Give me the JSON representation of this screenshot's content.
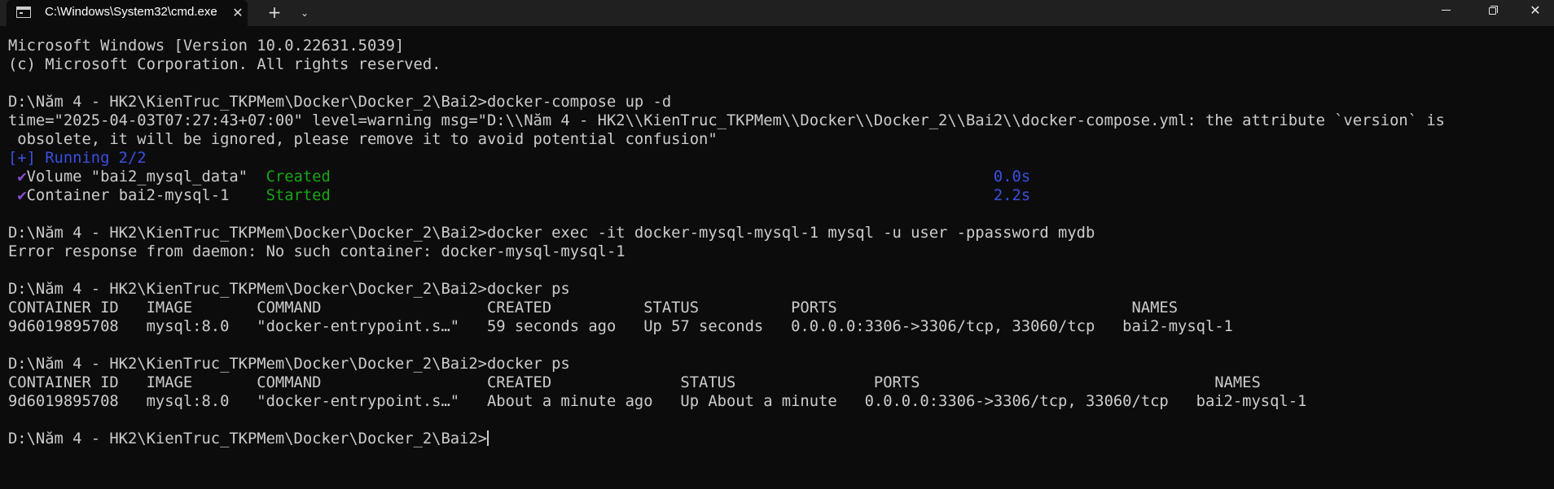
{
  "window": {
    "tab_title": "C:\\Windows\\System32\\cmd.exe",
    "close_tab_glyph": "✕",
    "new_tab_glyph": "+",
    "dropdown_glyph": "⌄",
    "close_window_glyph": "✕"
  },
  "terminal": {
    "banner_line1": "Microsoft Windows [Version 10.0.22631.5039]",
    "banner_line2": "(c) Microsoft Corporation. All rights reserved.",
    "cmd1": "D:\\Năm 4 - HK2\\KienTruc_TKPMem\\Docker\\Docker_2\\Bai2>docker-compose up -d",
    "warn_line1": "time=\"2025-04-03T07:27:43+07:00\" level=warning msg=\"D:\\\\Năm 4 - HK2\\\\KienTruc_TKPMem\\\\Docker\\\\Docker_2\\\\Bai2\\\\docker-compose.yml: the attribute `version` is",
    "warn_line2": " obsolete, it will be ignored, please remove it to avoid potential confusion\"",
    "running": "[+] Running 2/2",
    "check_glyph": "✔",
    "vol_label": "Volume \"bai2_mysql_data\"  ",
    "vol_status": "Created",
    "vol_time": "0.0s",
    "cont_label": "Container bai2-mysql-1    ",
    "cont_status": "Started",
    "cont_time": "2.2s",
    "cmd2": "D:\\Năm 4 - HK2\\KienTruc_TKPMem\\Docker\\Docker_2\\Bai2>docker exec -it docker-mysql-mysql-1 mysql -u user -ppassword mydb",
    "error_line": "Error response from daemon: No such container: docker-mysql-mysql-1",
    "cmd3": "D:\\Năm 4 - HK2\\KienTruc_TKPMem\\Docker\\Docker_2\\Bai2>docker ps",
    "ps1_header": "CONTAINER ID   IMAGE       COMMAND                  CREATED          STATUS          PORTS                                NAMES",
    "ps1_row": "9d6019895708   mysql:8.0   \"docker-entrypoint.s…\"   59 seconds ago   Up 57 seconds   0.0.0.0:3306->3306/tcp, 33060/tcp   bai2-mysql-1",
    "cmd4": "D:\\Năm 4 - HK2\\KienTruc_TKPMem\\Docker\\Docker_2\\Bai2>docker ps",
    "ps2_header": "CONTAINER ID   IMAGE       COMMAND                  CREATED              STATUS               PORTS                                NAMES",
    "ps2_row": "9d6019895708   mysql:8.0   \"docker-entrypoint.s…\"   About a minute ago   Up About a minute   0.0.0.0:3306->3306/tcp, 33060/tcp   bai2-mysql-1",
    "prompt": "D:\\Năm 4 - HK2\\KienTruc_TKPMem\\Docker\\Docker_2\\Bai2>"
  },
  "colors": {
    "background": "#0c0c0c",
    "titlebar": "#202020",
    "text": "#cccccc",
    "blue": "#3b4fe0",
    "green": "#16a616",
    "check": "#8a4fd8"
  },
  "icons": {
    "tab_icon": "terminal-icon",
    "minimize": "minimize-icon",
    "restore": "restore-icon",
    "close": "close-icon"
  }
}
